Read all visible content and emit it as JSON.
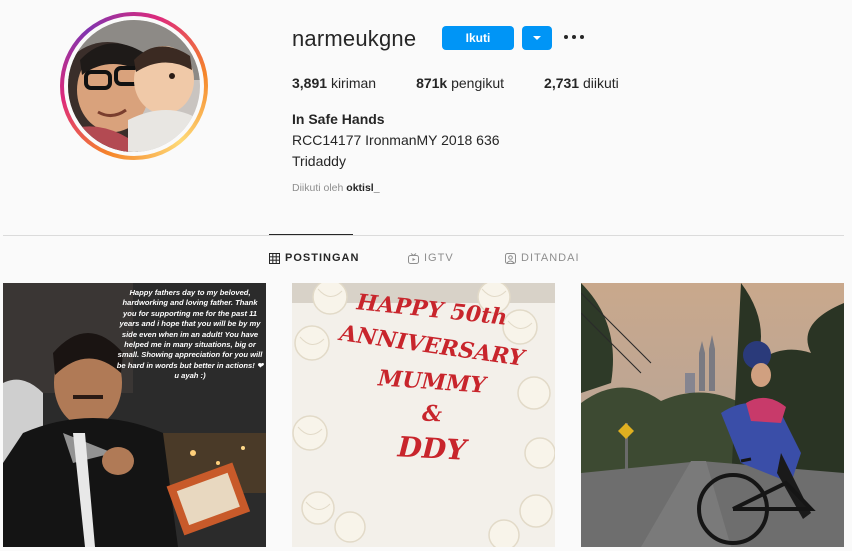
{
  "profile": {
    "username": "narmeukgne",
    "follow_label": "Ikuti",
    "stats": [
      {
        "count": "3,891",
        "label": "kiriman"
      },
      {
        "count": "871k",
        "label": "pengikut"
      },
      {
        "count": "2,731",
        "label": "diikuti"
      }
    ],
    "bio": {
      "name": "In Safe Hands",
      "line1": "RCC14177 IronmanMY 2018 636",
      "line2": "Tridaddy"
    },
    "followed_by": {
      "prefix": "Diikuti oleh",
      "user": "oktisl_"
    }
  },
  "tabs": [
    {
      "label": "POSTINGAN",
      "icon": "grid-icon"
    },
    {
      "label": "IGTV",
      "icon": "tv-icon"
    },
    {
      "label": "DITANDAI",
      "icon": "tag-icon"
    }
  ],
  "posts": {
    "post1_text": "Happy fathers day to my beloved, hardworking and loving father. Thank you for supporting me for the past 11 years and i hope  that you will be by my side even when im an adult! You have helped me in many situations, big or small. Showing appreciation for you will be hard in words but better in actions! ❤ u ayah :)",
    "post2_cake": [
      "HAPPY 50th",
      "ANNIVERSARY",
      "MUMMY",
      "&",
      "DDY"
    ]
  },
  "colors": {
    "accent": "#0095f6",
    "text": "#262626",
    "muted": "#8e8e8e",
    "border": "#dbdbdb"
  }
}
